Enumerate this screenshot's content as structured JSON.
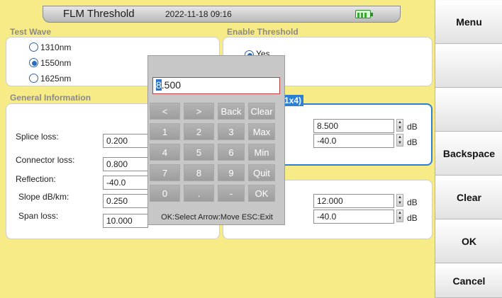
{
  "header": {
    "title": "FLM Threshold",
    "datetime": "2022-11-18 09:16",
    "battery_icon": "battery-icon"
  },
  "test_wave": {
    "label": "Test Wave",
    "options": [
      {
        "label": "1310nm",
        "selected": false
      },
      {
        "label": "1550nm",
        "selected": true
      },
      {
        "label": "1625nm",
        "selected": false
      }
    ]
  },
  "enable_threshold": {
    "label": "Enable Threshold",
    "yes_label": "Yes"
  },
  "general_info": {
    "label": "General Information",
    "rows": [
      {
        "label": "Splice loss:",
        "value": "0.200"
      },
      {
        "label": "Connector loss:",
        "value": "0.800"
      },
      {
        "label": "Reflection:",
        "value": "-40.0"
      },
      {
        "label": "Slope dB/km:",
        "value": "0.250"
      },
      {
        "label": "Span loss:",
        "value": "10.000"
      }
    ]
  },
  "splitter_panel": {
    "header_fragment": "1x4)",
    "rows": [
      {
        "value": "8.500",
        "unit": "dB"
      },
      {
        "value": "-40.0",
        "unit": "dB"
      }
    ]
  },
  "lower_panel": {
    "rows": [
      {
        "value": "12.000",
        "unit": "dB"
      },
      {
        "value": "-40.0",
        "unit": "dB"
      }
    ]
  },
  "keypad": {
    "input_first": "8",
    "input_rest": ".500",
    "keys": [
      [
        "<",
        ">",
        "Back",
        "Clear"
      ],
      [
        "1",
        "2",
        "3",
        "Max"
      ],
      [
        "4",
        "5",
        "6",
        "Min"
      ],
      [
        "7",
        "8",
        "9",
        "Quit"
      ],
      [
        "0",
        ".",
        "-",
        "OK"
      ]
    ],
    "help": "OK:Select Arrow:Move ESC:Exit"
  },
  "sidebar": {
    "buttons": [
      "Menu",
      "",
      "",
      "Backspace",
      "Clear",
      "OK",
      "Cancel"
    ]
  }
}
